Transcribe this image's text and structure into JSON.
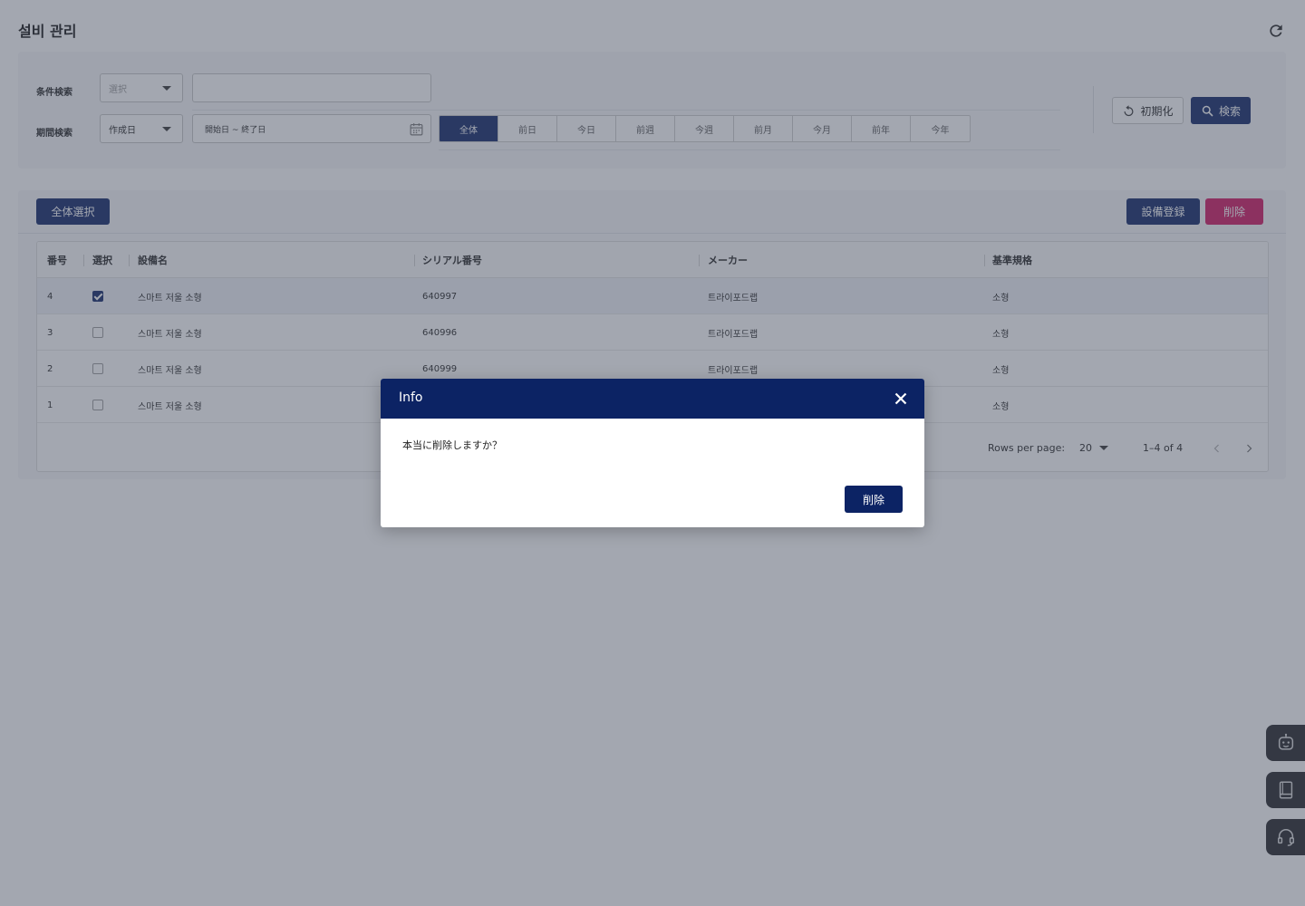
{
  "page": {
    "title": "설비 관리"
  },
  "search": {
    "condition_label": "条件検索",
    "condition_select_placeholder": "選択",
    "keyword_value": "",
    "period_label": "期間検索",
    "period_select_value": "作成日",
    "date_range": "開始日 ~ 終了日",
    "period_options": [
      {
        "label": "全体",
        "active": true
      },
      {
        "label": "前日",
        "active": false
      },
      {
        "label": "今日",
        "active": false
      },
      {
        "label": "前週",
        "active": false
      },
      {
        "label": "今週",
        "active": false
      },
      {
        "label": "前月",
        "active": false
      },
      {
        "label": "今月",
        "active": false
      },
      {
        "label": "前年",
        "active": false
      },
      {
        "label": "今年",
        "active": false
      }
    ],
    "reset_label": "初期化",
    "search_label": "検索"
  },
  "list": {
    "select_all_label": "全体選択",
    "register_label": "設備登録",
    "delete_label": "削除",
    "columns": [
      "番号",
      "選択",
      "設備名",
      "シリアル番号",
      "メーカー",
      "基準規格"
    ],
    "rows": [
      {
        "no": "4",
        "checked": true,
        "name": "스마트 저울 소형",
        "serial": "640997",
        "maker": "트라이포드랩",
        "spec": "소형"
      },
      {
        "no": "3",
        "checked": false,
        "name": "스마트 저울 소형",
        "serial": "640996",
        "maker": "트라이포드랩",
        "spec": "소형"
      },
      {
        "no": "2",
        "checked": false,
        "name": "스마트 저울 소형",
        "serial": "640999",
        "maker": "트라이포드랩",
        "spec": "소형"
      },
      {
        "no": "1",
        "checked": false,
        "name": "스마트 저울 소형",
        "serial": "",
        "maker": "",
        "spec": "소형"
      }
    ],
    "pagination": {
      "rows_per_page_label": "Rows per page:",
      "rows_per_page_value": "20",
      "range_text": "1–4 of 4"
    }
  },
  "dialog": {
    "title": "Info",
    "message": "本当に削除しますか？",
    "confirm_label": "削除"
  },
  "side_buttons": [
    "chatbot-icon",
    "manual-book-icon",
    "headset-support-icon"
  ],
  "colors": {
    "navy": "#0c2364",
    "danger": "#d1135e",
    "overlay": "rgba(72,80,98,0.5)"
  }
}
